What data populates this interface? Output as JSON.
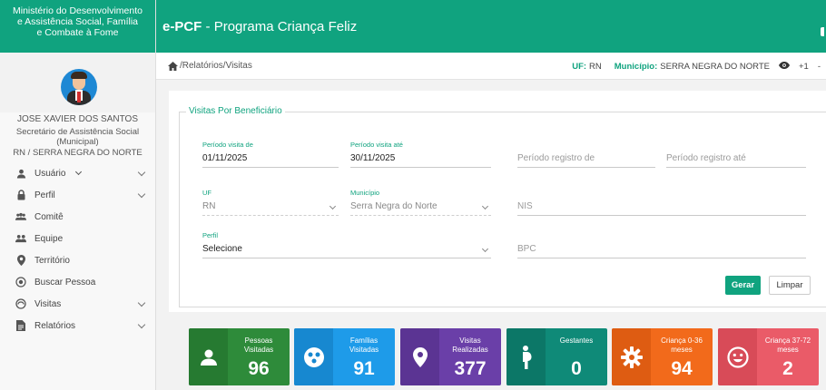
{
  "sidebar": {
    "org_line1": "Ministério do Desenvolvimento",
    "org_line2": "e Assistência Social, Família",
    "org_line3": "e Combate à Fome",
    "user_name": "JOSE XAVIER DOS SANTOS",
    "user_role_line1": "Secretário de Assistência Social",
    "user_role_line2": "(Municipal)",
    "user_location": "RN / SERRA NEGRA DO NORTE",
    "menu": [
      {
        "label": "Usuário",
        "icon": "person-icon"
      },
      {
        "label": "Perfil",
        "icon": "lock-icon"
      },
      {
        "label": "Comitê",
        "icon": "group-icon"
      },
      {
        "label": "Equipe",
        "icon": "team-icon"
      },
      {
        "label": "Território",
        "icon": "map-pin-icon"
      },
      {
        "label": "Buscar Pessoa",
        "icon": "target-icon"
      },
      {
        "label": "Visitas",
        "icon": "clock-icon"
      },
      {
        "label": "Relatórios",
        "icon": "document-icon"
      }
    ]
  },
  "header": {
    "app_short": "e-PCF",
    "app_sep": " - ",
    "app_name": "Programa Criança Feliz"
  },
  "breadcrumb": {
    "path": "/Relatórios/Visitas"
  },
  "context": {
    "uf_label": "UF:",
    "uf_value": "RN",
    "municipio_label": "Município:",
    "municipio_value": "SERRA NEGRA DO NORTE",
    "extra": "+1",
    "dash": "-"
  },
  "form": {
    "legend": "Visitas Por Beneficiário",
    "periodo_visita_de": {
      "label": "Período visita de",
      "value": "01/11/2025"
    },
    "periodo_visita_ate": {
      "label": "Período visita até",
      "value": "30/11/2025"
    },
    "periodo_registro_de": {
      "placeholder": "Período registro de"
    },
    "periodo_registro_ate": {
      "placeholder": "Período registro até"
    },
    "uf": {
      "label": "UF",
      "value": "RN"
    },
    "municipio": {
      "label": "Município",
      "value": "Serra Negra do Norte"
    },
    "nis": {
      "placeholder": "NIS"
    },
    "perfil": {
      "label": "Perfil",
      "value": "Selecione"
    },
    "bpc": {
      "placeholder": "BPC"
    },
    "btn_gerar": "Gerar",
    "btn_limpar": "Limpar"
  },
  "cards": [
    {
      "title1": "Pessoas",
      "title2": "Visitadas",
      "value": "96",
      "color": "#2e8b3a",
      "iconbg": "#267a31",
      "icon": "person-icon"
    },
    {
      "title1": "Famílias",
      "title2": "Visitadas",
      "value": "91",
      "color": "#1e9be9",
      "iconbg": "#1788d0",
      "icon": "family-icon"
    },
    {
      "title1": "Visitas",
      "title2": "Realizadas",
      "value": "377",
      "color": "#6a3fa8",
      "iconbg": "#5b3493",
      "icon": "map-pin-icon"
    },
    {
      "title1": "Gestantes",
      "title2": "",
      "value": "0",
      "color": "#0f8a78",
      "iconbg": "#0c7767",
      "icon": "pregnant-icon"
    },
    {
      "title1": "Criança 0-36",
      "title2": "meses",
      "value": "94",
      "color": "#f26a1b",
      "iconbg": "#de5c12",
      "icon": "gear-icon"
    },
    {
      "title1": "Criança 37-72",
      "title2": "meses",
      "value": "2",
      "color": "#ea5b68",
      "iconbg": "#d84b58",
      "icon": "smile-icon"
    }
  ]
}
